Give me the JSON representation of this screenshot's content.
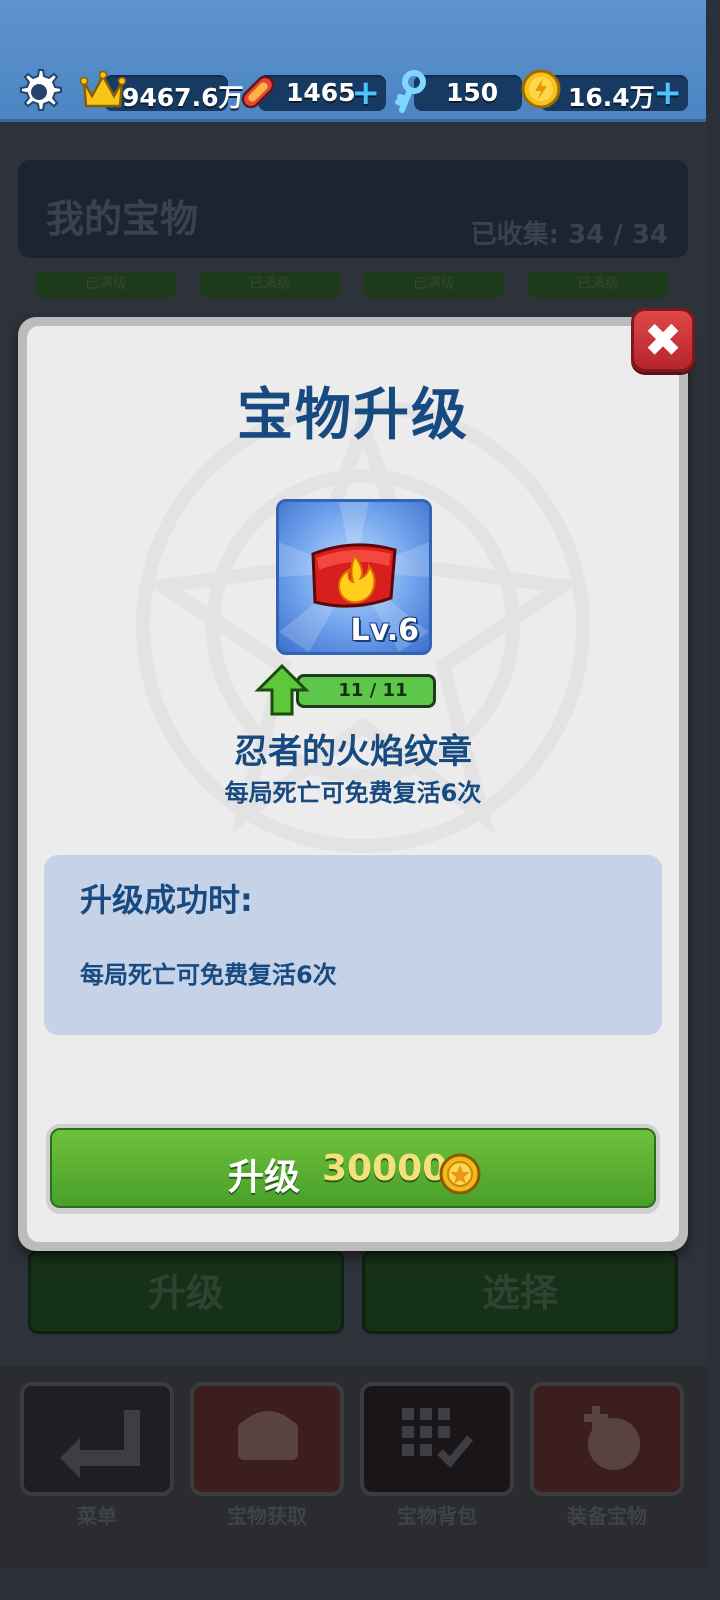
{
  "resources": {
    "crowns": "9467.6万",
    "boards": "1465",
    "keys": "150",
    "coins": "16.4万",
    "plus_symbol": "+"
  },
  "background": {
    "header_title": "我的宝物",
    "collected": "已收集: 34 / 34",
    "tab_label": "已满级",
    "buttons": {
      "upgrade": "升级",
      "select": "选择"
    },
    "nav": [
      {
        "label": "菜单",
        "icon": "back-arrow-icon"
      },
      {
        "label": "宝物获取",
        "icon": "treasure-chest-icon"
      },
      {
        "label": "宝物背包",
        "icon": "grid-check-icon"
      },
      {
        "label": "装备宝物",
        "icon": "equip-treasure-icon"
      }
    ]
  },
  "modal": {
    "title": "宝物升级",
    "close_symbol": "✖",
    "item": {
      "name": "忍者的火焰纹章",
      "level": "Lv.6",
      "progress_text": "11 / 11",
      "progress_fraction": 1.0,
      "description": "每局死亡可免费复活6次",
      "icon": "fire-emblem-icon"
    },
    "effect": {
      "title": "升级成功时:",
      "text": "每局死亡可免费复活6次"
    },
    "upgrade_button": {
      "label": "升级",
      "cost": "30000",
      "currency_icon": "coin-icon"
    }
  },
  "colors": {
    "title_blue": "#174a80",
    "button_green": "#5cb034",
    "close_red": "#d0383b",
    "top_bar": "#5490cb"
  }
}
